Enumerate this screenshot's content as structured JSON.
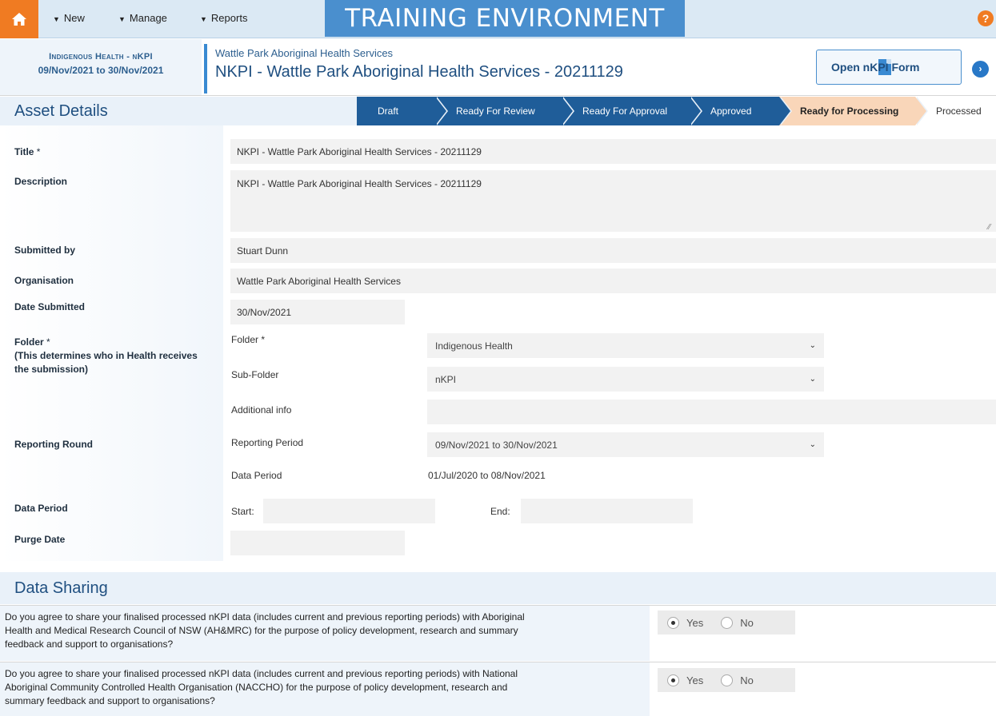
{
  "nav": {
    "menu": [
      {
        "label": "New"
      },
      {
        "label": "Manage"
      },
      {
        "label": "Reports"
      }
    ],
    "banner": "TRAINING ENVIRONMENT",
    "help": "?"
  },
  "header": {
    "category": "Indigenous Health - nKPI",
    "range": "09/Nov/2021 to 30/Nov/2021",
    "organisation": "Wattle Park Aboriginal Health Services",
    "title": "NKPI - Wattle Park Aboriginal Health Services - 20211129",
    "open_button": "Open nKPI Form"
  },
  "asset_details": {
    "section_title": "Asset Details",
    "workflow": [
      "Draft",
      "Ready For Review",
      "Ready For Approval",
      "Approved",
      "Ready for Processing",
      "Processed"
    ],
    "active_step": "Ready for Processing"
  },
  "form": {
    "title_label": "Title",
    "title_value": "NKPI - Wattle Park Aboriginal Health Services - 20211129",
    "description_label": "Description",
    "description_value": "NKPI - Wattle Park Aboriginal Health Services - 20211129",
    "submitted_by_label": "Submitted by",
    "submitted_by_value": "Stuart Dunn",
    "organisation_label": "Organisation",
    "organisation_value": "Wattle Park Aboriginal Health Services",
    "date_submitted_label": "Date Submitted",
    "date_submitted_value": "30/Nov/2021",
    "folder_label": "Folder",
    "folder_note": "(This determines who in Health receives the submission)",
    "folder_sub_label": "Folder",
    "folder_value": "Indigenous Health",
    "subfolder_label": "Sub-Folder",
    "subfolder_value": "nKPI",
    "additional_info_label": "Additional info",
    "additional_info_value": "",
    "reporting_round_label": "Reporting Round",
    "reporting_period_label": "Reporting Period",
    "reporting_period_value": "09/Nov/2021 to 30/Nov/2021",
    "data_period_sub_label": "Data Period",
    "data_period_sub_value": "01/Jul/2020 to 08/Nov/2021",
    "data_period_label": "Data Period",
    "start_label": "Start:",
    "start_value": "",
    "end_label": "End:",
    "end_value": "",
    "purge_date_label": "Purge Date",
    "purge_date_value": "",
    "required_mark": "*"
  },
  "data_sharing": {
    "section_title": "Data Sharing",
    "questions": [
      {
        "lines": [
          "Do you agree to share your finalised processed nKPI data (includes current and previous reporting periods) with Aboriginal",
          "Health and Medical Research Council of NSW (AH&MRC) for the purpose of policy development, research and summary",
          "feedback and support to organisations?"
        ],
        "yes": "Yes",
        "no": "No",
        "selected": "Yes"
      },
      {
        "lines": [
          "Do you agree to share your finalised processed nKPI data (includes current and previous reporting periods) with National",
          "Aboriginal Community Controlled Health Organisation (NACCHO) for the purpose of policy development, research and",
          "summary feedback and support to organisations?"
        ],
        "yes": "Yes",
        "no": "No",
        "selected": "Yes"
      }
    ]
  },
  "colors": {
    "home_orange": "#f07b22",
    "banner_blue": "#4a8fce",
    "workflow_dark": "#1f5d99",
    "workflow_active": "#f9d6b9",
    "title_blue": "#1f4f80"
  }
}
